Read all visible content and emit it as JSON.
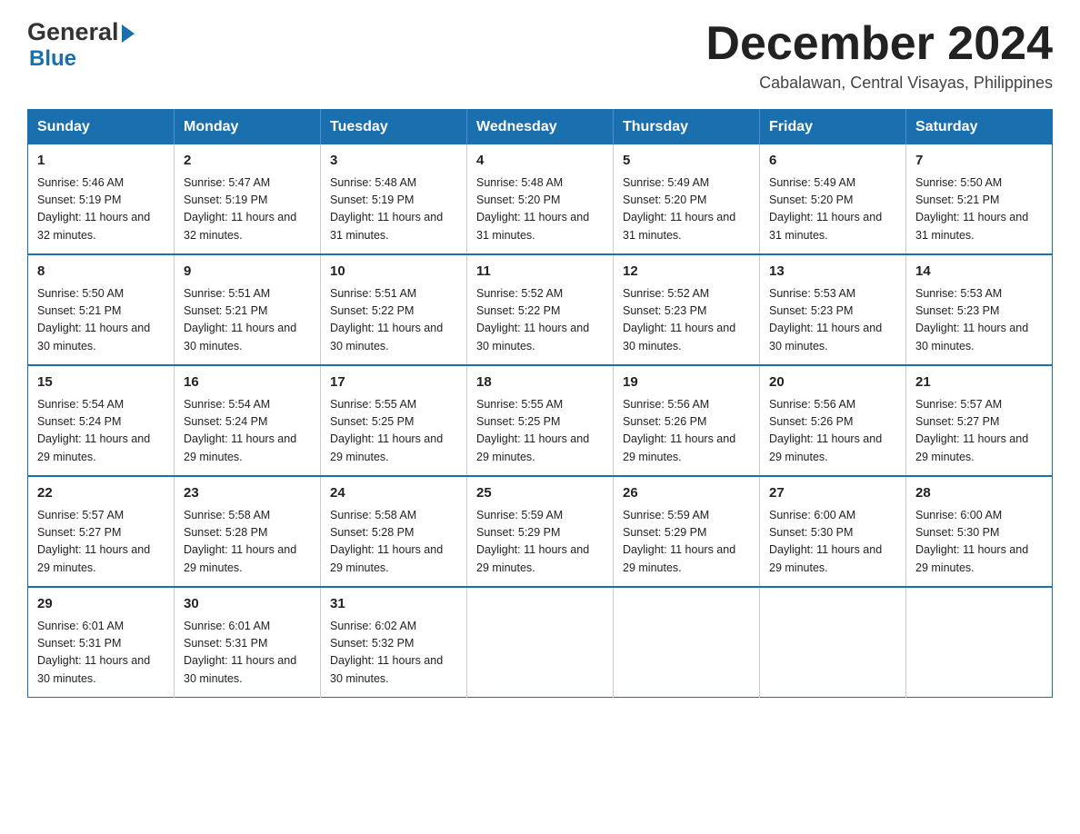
{
  "header": {
    "logo_line1": "General",
    "logo_line2": "Blue",
    "month_title": "December 2024",
    "location": "Cabalawan, Central Visayas, Philippines"
  },
  "days_of_week": [
    "Sunday",
    "Monday",
    "Tuesday",
    "Wednesday",
    "Thursday",
    "Friday",
    "Saturday"
  ],
  "weeks": [
    [
      {
        "day": "1",
        "sunrise": "5:46 AM",
        "sunset": "5:19 PM",
        "daylight": "11 hours and 32 minutes."
      },
      {
        "day": "2",
        "sunrise": "5:47 AM",
        "sunset": "5:19 PM",
        "daylight": "11 hours and 32 minutes."
      },
      {
        "day": "3",
        "sunrise": "5:48 AM",
        "sunset": "5:19 PM",
        "daylight": "11 hours and 31 minutes."
      },
      {
        "day": "4",
        "sunrise": "5:48 AM",
        "sunset": "5:20 PM",
        "daylight": "11 hours and 31 minutes."
      },
      {
        "day": "5",
        "sunrise": "5:49 AM",
        "sunset": "5:20 PM",
        "daylight": "11 hours and 31 minutes."
      },
      {
        "day": "6",
        "sunrise": "5:49 AM",
        "sunset": "5:20 PM",
        "daylight": "11 hours and 31 minutes."
      },
      {
        "day": "7",
        "sunrise": "5:50 AM",
        "sunset": "5:21 PM",
        "daylight": "11 hours and 31 minutes."
      }
    ],
    [
      {
        "day": "8",
        "sunrise": "5:50 AM",
        "sunset": "5:21 PM",
        "daylight": "11 hours and 30 minutes."
      },
      {
        "day": "9",
        "sunrise": "5:51 AM",
        "sunset": "5:21 PM",
        "daylight": "11 hours and 30 minutes."
      },
      {
        "day": "10",
        "sunrise": "5:51 AM",
        "sunset": "5:22 PM",
        "daylight": "11 hours and 30 minutes."
      },
      {
        "day": "11",
        "sunrise": "5:52 AM",
        "sunset": "5:22 PM",
        "daylight": "11 hours and 30 minutes."
      },
      {
        "day": "12",
        "sunrise": "5:52 AM",
        "sunset": "5:23 PM",
        "daylight": "11 hours and 30 minutes."
      },
      {
        "day": "13",
        "sunrise": "5:53 AM",
        "sunset": "5:23 PM",
        "daylight": "11 hours and 30 minutes."
      },
      {
        "day": "14",
        "sunrise": "5:53 AM",
        "sunset": "5:23 PM",
        "daylight": "11 hours and 30 minutes."
      }
    ],
    [
      {
        "day": "15",
        "sunrise": "5:54 AM",
        "sunset": "5:24 PM",
        "daylight": "11 hours and 29 minutes."
      },
      {
        "day": "16",
        "sunrise": "5:54 AM",
        "sunset": "5:24 PM",
        "daylight": "11 hours and 29 minutes."
      },
      {
        "day": "17",
        "sunrise": "5:55 AM",
        "sunset": "5:25 PM",
        "daylight": "11 hours and 29 minutes."
      },
      {
        "day": "18",
        "sunrise": "5:55 AM",
        "sunset": "5:25 PM",
        "daylight": "11 hours and 29 minutes."
      },
      {
        "day": "19",
        "sunrise": "5:56 AM",
        "sunset": "5:26 PM",
        "daylight": "11 hours and 29 minutes."
      },
      {
        "day": "20",
        "sunrise": "5:56 AM",
        "sunset": "5:26 PM",
        "daylight": "11 hours and 29 minutes."
      },
      {
        "day": "21",
        "sunrise": "5:57 AM",
        "sunset": "5:27 PM",
        "daylight": "11 hours and 29 minutes."
      }
    ],
    [
      {
        "day": "22",
        "sunrise": "5:57 AM",
        "sunset": "5:27 PM",
        "daylight": "11 hours and 29 minutes."
      },
      {
        "day": "23",
        "sunrise": "5:58 AM",
        "sunset": "5:28 PM",
        "daylight": "11 hours and 29 minutes."
      },
      {
        "day": "24",
        "sunrise": "5:58 AM",
        "sunset": "5:28 PM",
        "daylight": "11 hours and 29 minutes."
      },
      {
        "day": "25",
        "sunrise": "5:59 AM",
        "sunset": "5:29 PM",
        "daylight": "11 hours and 29 minutes."
      },
      {
        "day": "26",
        "sunrise": "5:59 AM",
        "sunset": "5:29 PM",
        "daylight": "11 hours and 29 minutes."
      },
      {
        "day": "27",
        "sunrise": "6:00 AM",
        "sunset": "5:30 PM",
        "daylight": "11 hours and 29 minutes."
      },
      {
        "day": "28",
        "sunrise": "6:00 AM",
        "sunset": "5:30 PM",
        "daylight": "11 hours and 29 minutes."
      }
    ],
    [
      {
        "day": "29",
        "sunrise": "6:01 AM",
        "sunset": "5:31 PM",
        "daylight": "11 hours and 30 minutes."
      },
      {
        "day": "30",
        "sunrise": "6:01 AM",
        "sunset": "5:31 PM",
        "daylight": "11 hours and 30 minutes."
      },
      {
        "day": "31",
        "sunrise": "6:02 AM",
        "sunset": "5:32 PM",
        "daylight": "11 hours and 30 minutes."
      },
      null,
      null,
      null,
      null
    ]
  ],
  "labels": {
    "sunrise_prefix": "Sunrise: ",
    "sunset_prefix": "Sunset: ",
    "daylight_prefix": "Daylight: "
  }
}
